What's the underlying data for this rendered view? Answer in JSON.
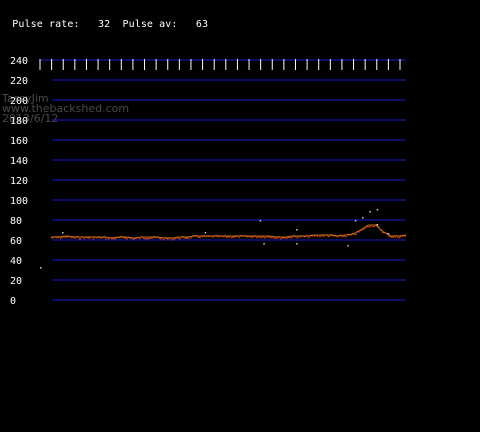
{
  "header": {
    "rate_label": "Pulse rate:",
    "rate_value": "32",
    "avg_label": "Pulse av:",
    "avg_value": "63"
  },
  "watermark": {
    "line1": "TassyJim",
    "line2": "www.thebackshed.com",
    "line3": "2013/6/12"
  },
  "colors": {
    "background": "#000000",
    "grid": "#1a1acc",
    "tick": "#ffffff",
    "label": "#ffffff",
    "raw_points": "#d84010",
    "average_line": "#c87820",
    "outlier_points": "#c8c8c8",
    "watermark": "#4a4a4a"
  },
  "chart_data": {
    "type": "line",
    "title": "",
    "xlabel": "",
    "ylabel": "",
    "ylim": [
      0,
      240
    ],
    "yticks": [
      "0",
      "20",
      "40",
      "60",
      "80",
      "100",
      "120",
      "140",
      "160",
      "180",
      "200",
      "220",
      "240"
    ],
    "grid": true,
    "legend": "none",
    "x_tick_count": 32,
    "series": [
      {
        "values": [
          63,
          63,
          64,
          63,
          63,
          63,
          63,
          63,
          62,
          63,
          63,
          62,
          63,
          63,
          63,
          62,
          62,
          63,
          63,
          64,
          64,
          64,
          64,
          64,
          64,
          64,
          64,
          64,
          64,
          64,
          63,
          63,
          64,
          64,
          64,
          65,
          65,
          65,
          64,
          65,
          66,
          70,
          75,
          75,
          68,
          64,
          64,
          65
        ]
      }
    ],
    "outliers": [
      {
        "x": 0.06,
        "y": 68
      },
      {
        "x": 0.45,
        "y": 68
      },
      {
        "x": 0.6,
        "y": 80
      },
      {
        "x": 0.61,
        "y": 57
      },
      {
        "x": 0.7,
        "y": 71
      },
      {
        "x": 0.7,
        "y": 57
      },
      {
        "x": 0.84,
        "y": 55
      },
      {
        "x": 0.86,
        "y": 80
      },
      {
        "x": 0.88,
        "y": 83
      },
      {
        "x": 0.9,
        "y": 89
      },
      {
        "x": 0.92,
        "y": 91
      },
      {
        "x": 0.92,
        "y": 76
      },
      {
        "x": 0.95,
        "y": 67
      },
      {
        "x": 0.0,
        "y": 33
      }
    ]
  }
}
